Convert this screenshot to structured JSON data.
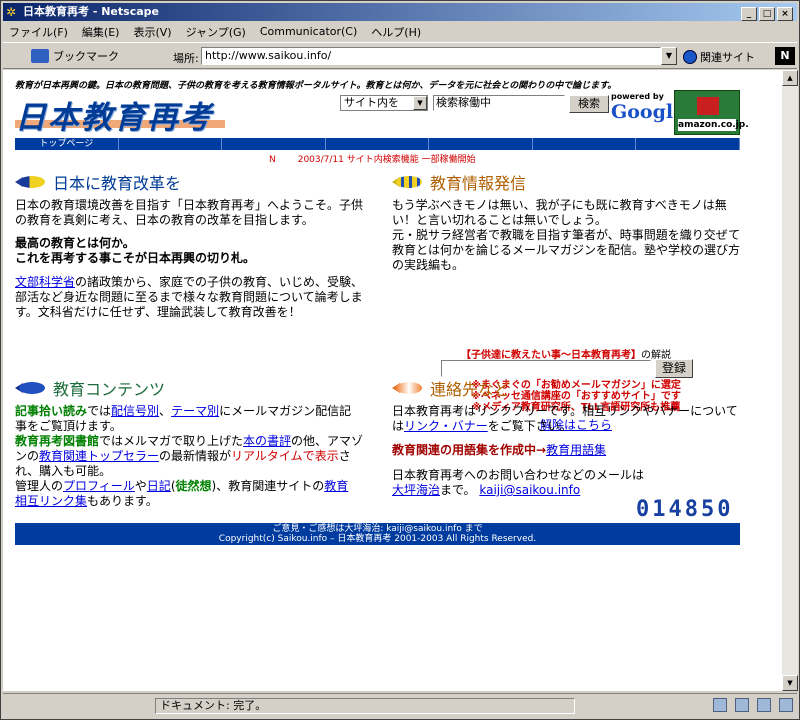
{
  "window": {
    "title": "日本教育再考 - Netscape"
  },
  "menu": [
    "ファイル(F)",
    "編集(E)",
    "表示(V)",
    "ジャンプ(G)",
    "Communicator(C)",
    "ヘルプ(H)"
  ],
  "toolbar": {
    "bookmark": "ブックマーク",
    "location_label": "場所:",
    "url": "http://www.saikou.info/",
    "related": "関連サイト",
    "nlogo": "N"
  },
  "status": {
    "text": "ドキュメント: 完了。"
  },
  "page": {
    "tagline": "教育が日本再興の鍵。日本の教育問題、子供の教育を考える教育情報ポータルサイト。教育とは何か、データを元に社会との関わりの中で論じます。",
    "logo": "日本教育再考",
    "search": {
      "select": "サイト内を",
      "input": "検索稼働中",
      "button": "検索"
    },
    "google": {
      "powered": "powered by",
      "brand": "Google"
    },
    "amazon": "amazon.co.jp.",
    "nav": [
      "トップページ",
      "",
      "",
      "",
      "",
      "",
      ""
    ],
    "news": {
      "mark": "N",
      "text": "2003/7/11 サイト内検索機能 一部稼働開始"
    },
    "sec1": {
      "title": "日本に教育改革を",
      "p1": "日本の教育環境改善を目指す「日本教育再考」へようこそ。子供の教育を真剣に考え、日本の教育の改革を目指します。",
      "bold1": "最高の教育とは何か。",
      "bold2": "これを再考する事こそが日本再興の切り札。",
      "link": "文部科学省",
      "p3": "の諸政策から、家庭での子供の教育、いじめ、受験、部活など身近な問題に至るまで様々な教育問題について論考します。文科省だけに任せず、理論武装して教育改善を！"
    },
    "sec2": {
      "title": "教育情報発信",
      "p1": "もう学ぶべきモノは無い、我が子にも既に教育すべきモノは無い！と言い切れることは無いでしょう。",
      "p2": "元・脱サラ経営者で教職を目指す筆者が、時事問題を織り交ぜて教育とは何かを論じるメールマガジンを配信。塾や学校の選び方の実践編も。"
    },
    "mag": {
      "title_red": "【子供達に教えたい事〜日本教育再考】",
      "title_rest": "の解説",
      "button": "登録",
      "note1": "※まぐまぐの「お勧めメールマガジン」に選定",
      "note2": "※ベネッセ通信講座の「おすすめサイト」です",
      "note3": "※メディア教育研究所、TLL言語研究所も推薦",
      "cancel": "解除はこちら"
    },
    "sec3": {
      "title": "教育コンテンツ",
      "l1a": "記事拾い読み",
      "l1b": "では",
      "l1c": "配信号別",
      "l1d": "、",
      "l1e": "テーマ別",
      "l1f": "にメールマガジン配信記事をご覧頂けます。",
      "l2a": "教育再考図書館",
      "l2b": "ではメルマガで取り上げた",
      "l2c": "本の書評",
      "l2d": "の他、アマゾンの",
      "l2e": "教育関連トップセラー",
      "l2f": "の最新情報が",
      "l2g": "リアルタイムで表示",
      "l2h": "され、購入も可能。",
      "l3a": "管理人の",
      "l3b": "プロフィール",
      "l3c": "や",
      "l3d": "日記",
      "l3e": "(",
      "l3f": "徒然想",
      "l3g": ")、教育関連サイトの",
      "l3h": "教育相互リンク集",
      "l3i": "もあります。"
    },
    "sec4": {
      "title": "連絡先など",
      "p1a": "日本教育再考はリンクフリーです。相互リンクやバナーについては",
      "p1b": "リンク・バナー",
      "p1c": "をご覧下さい。",
      "glossary_a": "教育関連の用語集を作成中→",
      "glossary_b": "教育用語集",
      "p3": "日本教育再考へのお問い合わせなどのメールは",
      "contact_a": "大坪海治",
      "contact_b": "まで。",
      "email": "kaiji@saikou.info"
    },
    "counter": "014850",
    "footer": {
      "line1": "ご意見・ご感想は大坪海治: kaiji@saikou.info まで",
      "line2": "Copyright(c) Saikou.info – 日本教育再考 2001-2003 All Rights Reserved."
    }
  }
}
